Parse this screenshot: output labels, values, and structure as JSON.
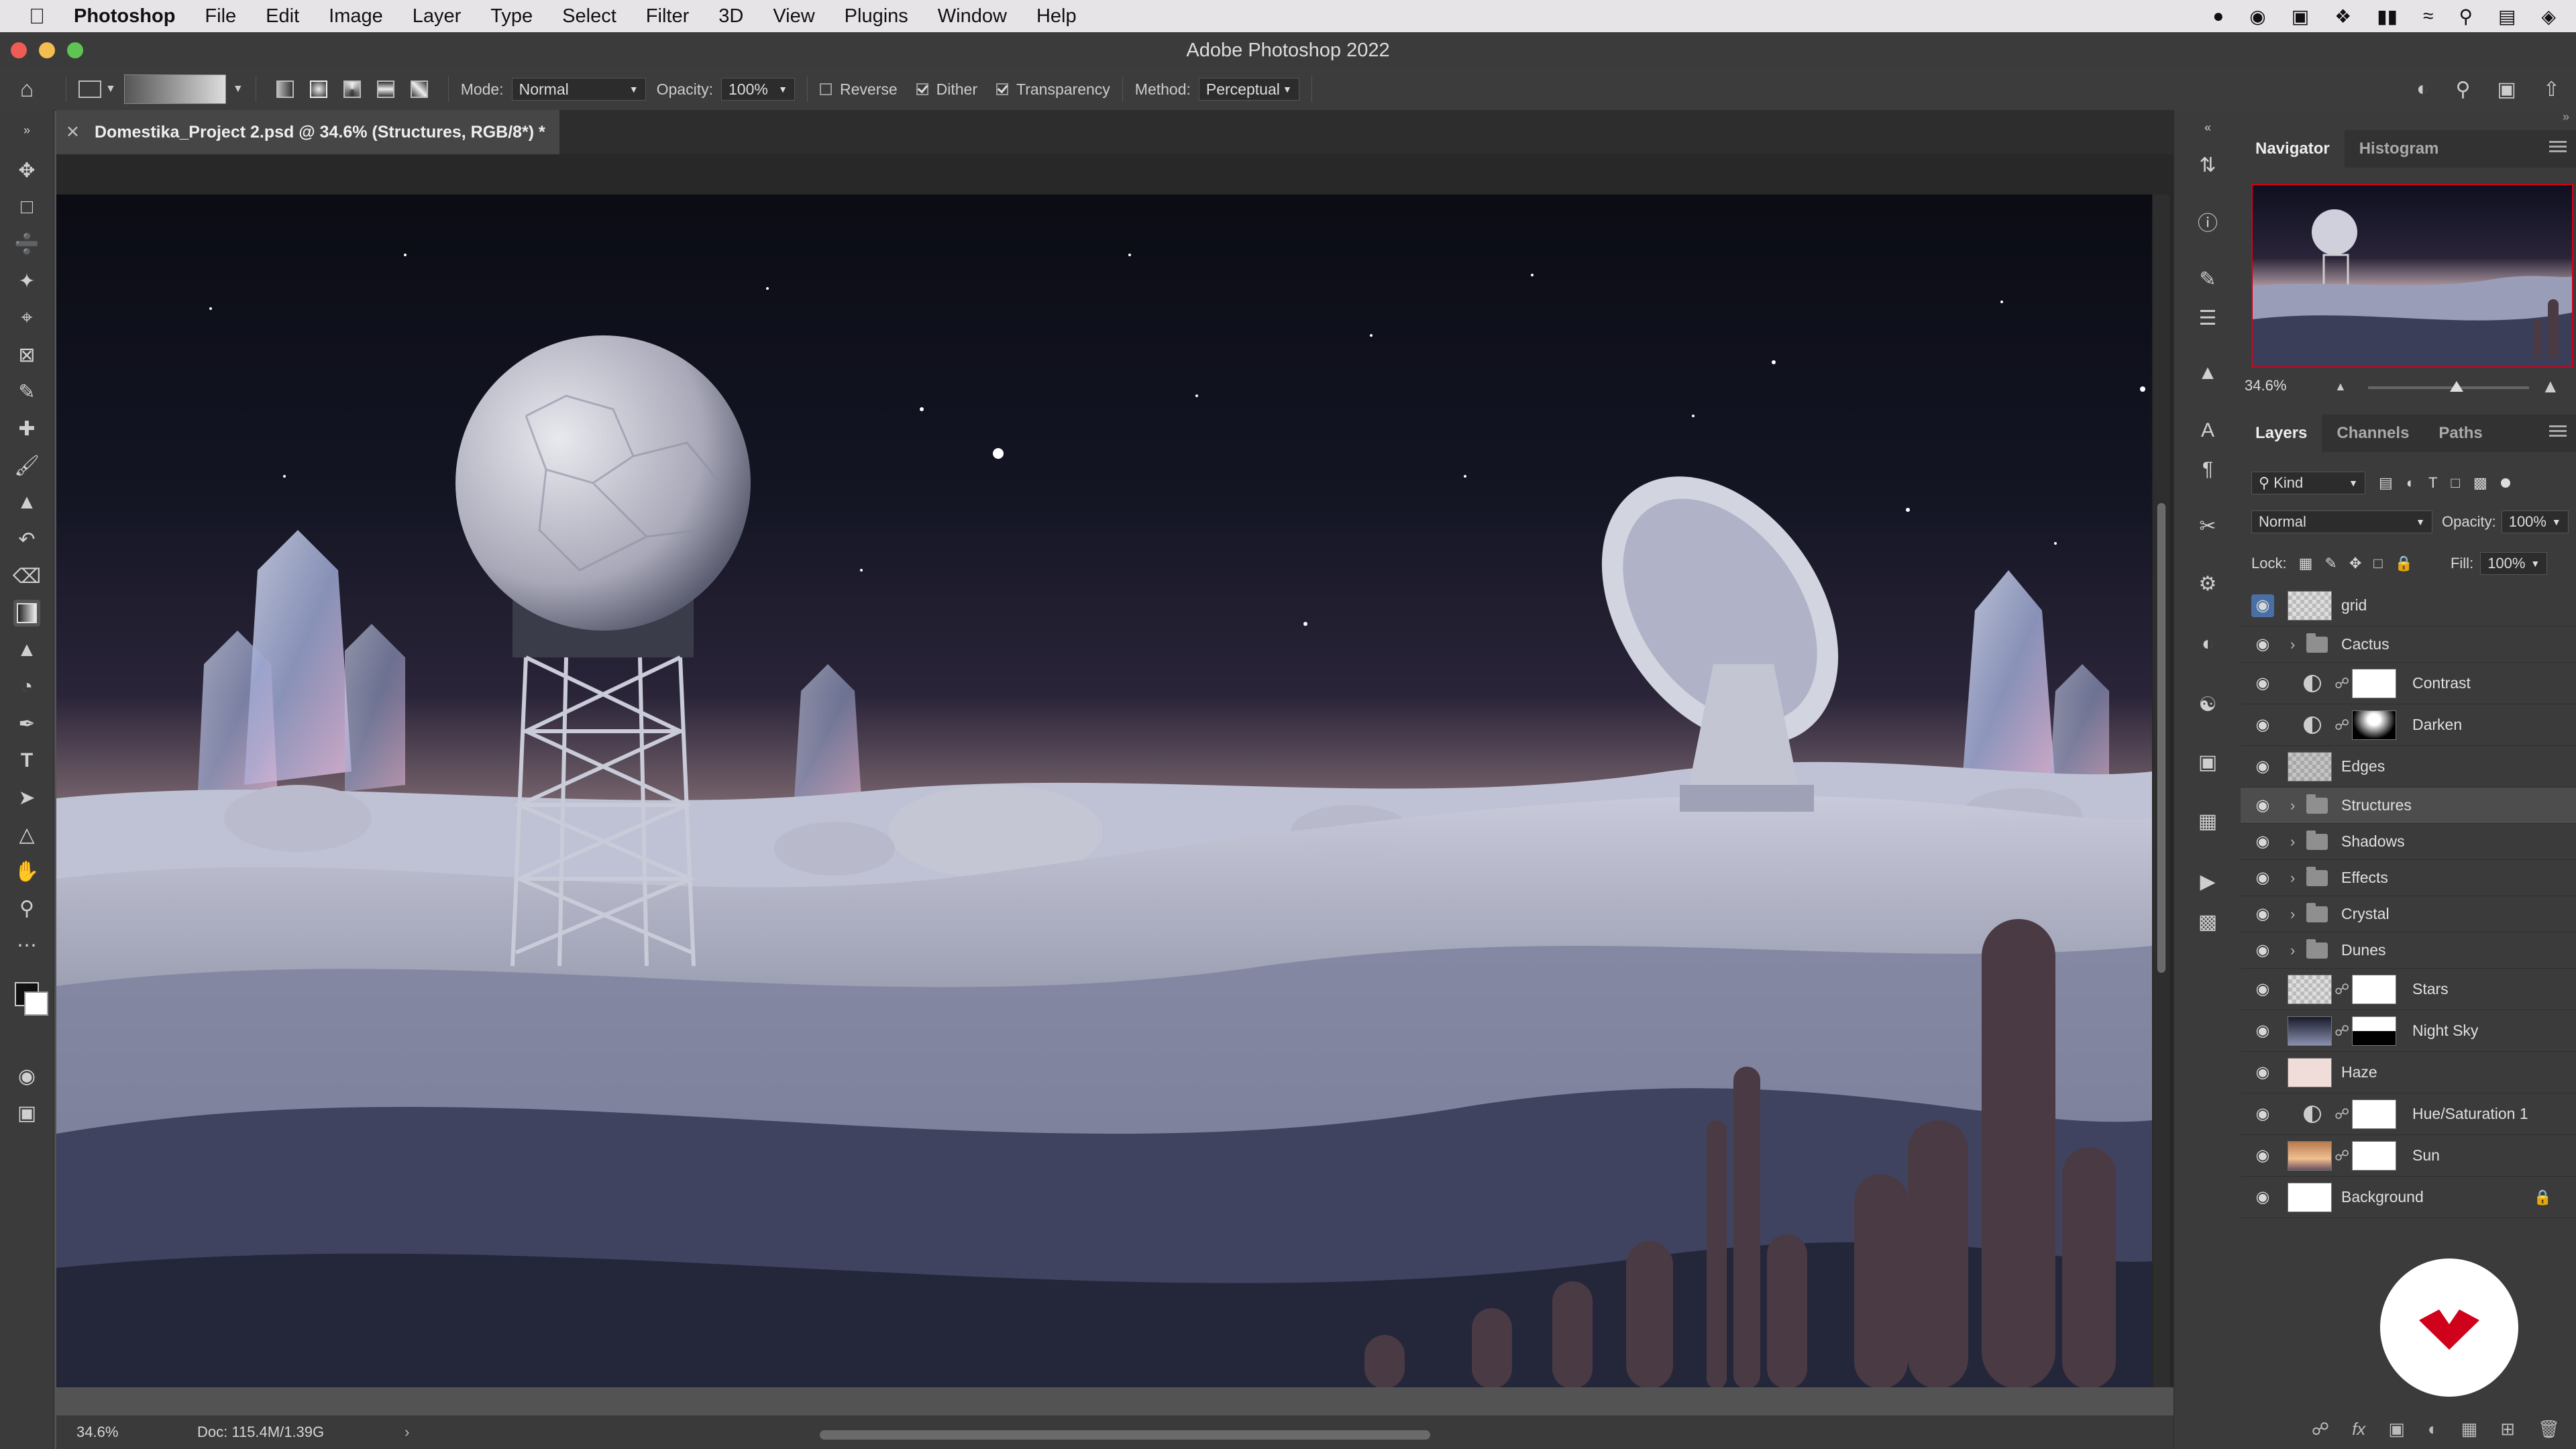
{
  "menubar": {
    "app_name": "Photoshop",
    "items": [
      "File",
      "Edit",
      "Image",
      "Layer",
      "Type",
      "Select",
      "Filter",
      "3D",
      "View",
      "Plugins",
      "Window",
      "Help"
    ],
    "status_icons": [
      "creative-cloud-icon",
      "sync-icon",
      "screen-icon",
      "bluetooth-icon",
      "battery-icon",
      "wifi-icon",
      "search-icon",
      "control-center-icon",
      "siri-icon"
    ]
  },
  "window": {
    "title": "Adobe Photoshop 2022"
  },
  "options_bar": {
    "mode_label": "Mode:",
    "mode_value": "Normal",
    "opacity_label": "Opacity:",
    "opacity_value": "100%",
    "reverse_label": "Reverse",
    "dither_label": "Dither",
    "transparency_label": "Transparency",
    "method_label": "Method:",
    "method_value": "Perceptual",
    "reverse_checked": false,
    "dither_checked": true,
    "transparency_checked": true
  },
  "document": {
    "tab_title": "Domestika_Project 2.psd @ 34.6% (Structures, RGB/8*) *",
    "zoom": "34.6%",
    "doc_size": "Doc: 115.4M/1.39G"
  },
  "navigator": {
    "tabs": [
      "Navigator",
      "Histogram"
    ],
    "zoom": "34.6%",
    "zoom_level": 0.55
  },
  "layers_panel": {
    "tabs": [
      "Layers",
      "Channels",
      "Paths"
    ],
    "filter_kind": "Kind",
    "blend_mode": "Normal",
    "opacity_label": "Opacity:",
    "opacity_value": "100%",
    "lock_label": "Lock:",
    "fill_label": "Fill:",
    "fill_value": "100%",
    "layers": [
      {
        "name": "grid",
        "type": "pixel",
        "thumb": "checker"
      },
      {
        "name": "Cactus",
        "type": "group"
      },
      {
        "name": "Contrast",
        "type": "adjustment",
        "indent": true,
        "mask": "white"
      },
      {
        "name": "Darken",
        "type": "adjustment",
        "indent": true,
        "mask": "dark"
      },
      {
        "name": "Edges",
        "type": "pixel",
        "thumb": "checker-light"
      },
      {
        "name": "Structures",
        "type": "group",
        "selected": true
      },
      {
        "name": "Shadows",
        "type": "group"
      },
      {
        "name": "Effects",
        "type": "group"
      },
      {
        "name": "Crystal",
        "type": "group"
      },
      {
        "name": "Dunes",
        "type": "group"
      },
      {
        "name": "Stars",
        "type": "pixel",
        "thumb": "checker",
        "mask": "white-dot"
      },
      {
        "name": "Night Sky",
        "type": "pixel",
        "thumb": "sky",
        "mask": "half"
      },
      {
        "name": "Haze",
        "type": "pixel",
        "thumb": "haze"
      },
      {
        "name": "Hue/Saturation 1",
        "type": "adjustment",
        "mask": "white"
      },
      {
        "name": "Sun",
        "type": "pixel",
        "thumb": "sun",
        "mask": "white-dot"
      },
      {
        "name": "Background",
        "type": "pixel",
        "thumb": "white",
        "locked": true
      }
    ]
  },
  "colors": {
    "accent_red": "#d0021b",
    "selected_row": "#4d4d4d",
    "panel_bg": "#3b3b3b"
  }
}
